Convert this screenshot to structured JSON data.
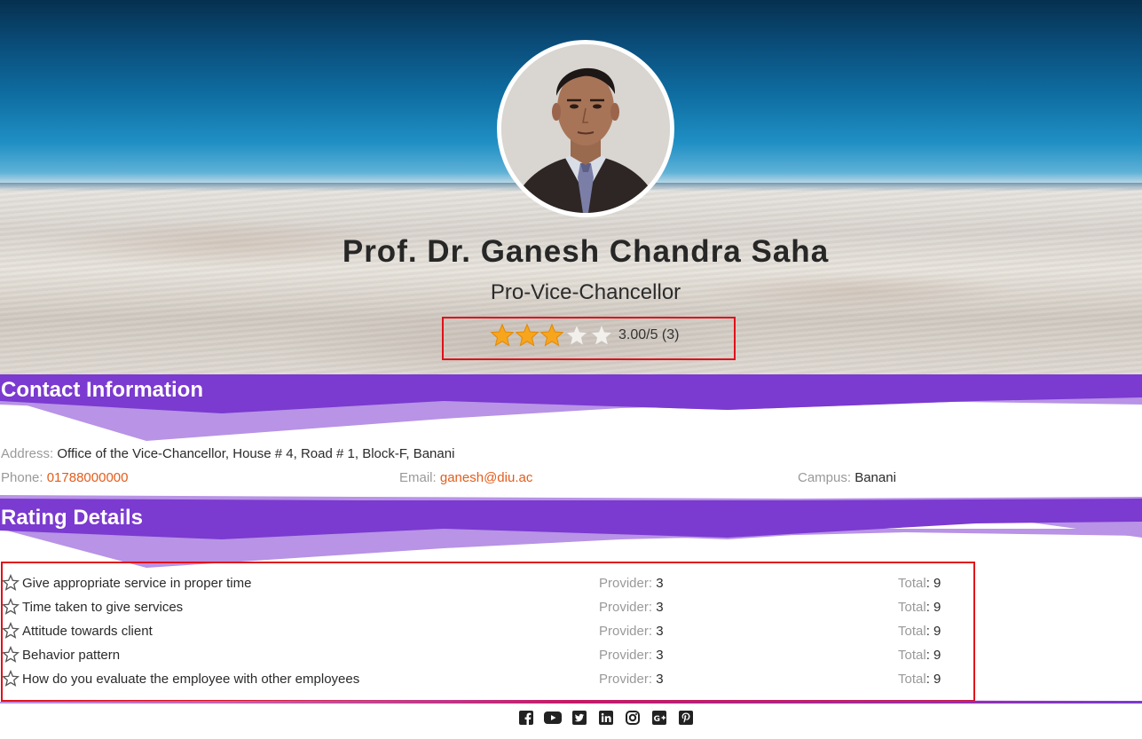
{
  "profile": {
    "name": "Prof. Dr. Ganesh Chandra Saha",
    "designation": "Pro-Vice-Chancellor",
    "rating_value": 3,
    "rating_max": 5,
    "rating_text": "3.00/5 (3)"
  },
  "contact": {
    "title": "Contact Information",
    "address_label": "Address:",
    "address_value": "Office of the Vice-Chancellor, House # 4, Road # 1, Block-F, Banani",
    "phone_label": "Phone:",
    "phone_value": "01788000000",
    "email_label": "Email:",
    "email_value": "ganesh@diu.ac",
    "campus_label": "Campus:",
    "campus_value": "Banani"
  },
  "rating_details": {
    "title": "Rating Details",
    "provider_label": "Provider:",
    "total_label": "Total",
    "rows": [
      {
        "criterion": "Give appropriate service in proper time",
        "provider": "3",
        "total": ": 9"
      },
      {
        "criterion": "Time taken to give services",
        "provider": "3",
        "total": ": 9"
      },
      {
        "criterion": "Attitude towards client",
        "provider": "3",
        "total": ": 9"
      },
      {
        "criterion": "Behavior pattern",
        "provider": "3",
        "total": ": 9"
      },
      {
        "criterion": "How do you evaluate the employee with other employees",
        "provider": "3",
        "total": ": 9"
      }
    ]
  },
  "social": [
    "facebook-icon",
    "youtube-icon",
    "twitter-icon",
    "linkedin-icon",
    "instagram-icon",
    "google-plus-icon",
    "pinterest-icon"
  ],
  "colors": {
    "header_purple": "#7b3ad0",
    "header_light": "#b893e6",
    "link_orange": "#e35c1b",
    "highlight_red": "#e0101a",
    "star_gold": "#f7a51c"
  }
}
